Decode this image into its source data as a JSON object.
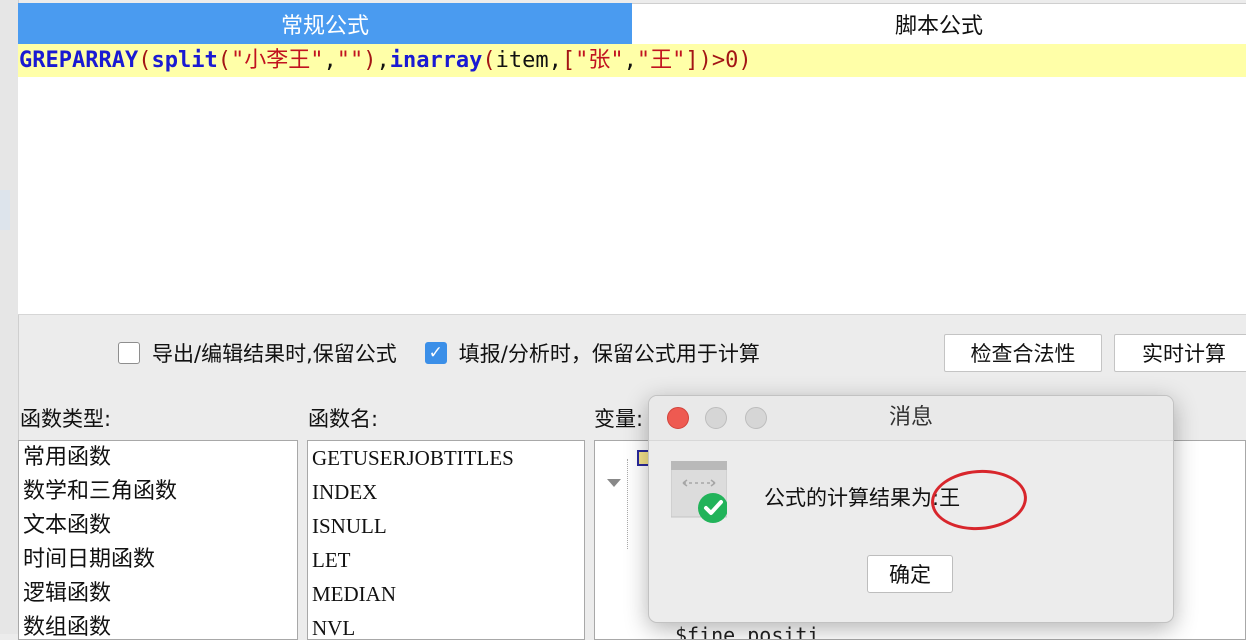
{
  "tabs": [
    {
      "label": "常规公式",
      "active": true
    },
    {
      "label": "脚本公式",
      "active": false
    }
  ],
  "editor": {
    "tokens": [
      {
        "text": "GREPARRAY",
        "type": "fn"
      },
      {
        "text": "(",
        "type": "p"
      },
      {
        "text": "split",
        "type": "fn"
      },
      {
        "text": "(",
        "type": "p"
      },
      {
        "text": "\"小李王\"",
        "type": "s"
      },
      {
        "text": ",",
        "type": "t"
      },
      {
        "text": "\"\"",
        "type": "s"
      },
      {
        "text": ")",
        "type": "p"
      },
      {
        "text": ",",
        "type": "t"
      },
      {
        "text": "inarray",
        "type": "fn"
      },
      {
        "text": "(",
        "type": "p"
      },
      {
        "text": "item,",
        "type": "t"
      },
      {
        "text": "[",
        "type": "p"
      },
      {
        "text": "\"张\"",
        "type": "s"
      },
      {
        "text": ",",
        "type": "t"
      },
      {
        "text": "\"王\"",
        "type": "s"
      },
      {
        "text": "]",
        "type": "p"
      },
      {
        "text": ")",
        "type": "p"
      },
      {
        "text": ">0",
        "type": "n"
      },
      {
        "text": ")",
        "type": "p"
      }
    ]
  },
  "options": {
    "export_keep": {
      "label": "导出/编辑结果时,保留公式",
      "checked": false
    },
    "fill_keep": {
      "label": "填报/分析时，保留公式用于计算",
      "checked": true
    }
  },
  "buttons": {
    "check": "检查合法性",
    "realtime": "实时计算"
  },
  "panels": {
    "func_type_label": "函数类型:",
    "func_name_label": "函数名:",
    "var_label": "变量:"
  },
  "func_types": [
    "常用函数",
    "数学和三角函数",
    "文本函数",
    "时间日期函数",
    "逻辑函数",
    "数组函数"
  ],
  "func_names": [
    "GETUSERJOBTITLES",
    "INDEX",
    "ISNULL",
    "LET",
    "MEDIAN",
    "NVL"
  ],
  "var_partial": "$fine_positi",
  "dialog": {
    "title": "消息",
    "message": "公式的计算结果为:王",
    "ok": "确定"
  },
  "colors": {
    "tab_active": "#4a9bf0",
    "editor_highlight": "#ffffa8",
    "checkbox_on": "#3b8fe8",
    "annotation": "#d8262c",
    "success_icon": "#22b35a"
  }
}
